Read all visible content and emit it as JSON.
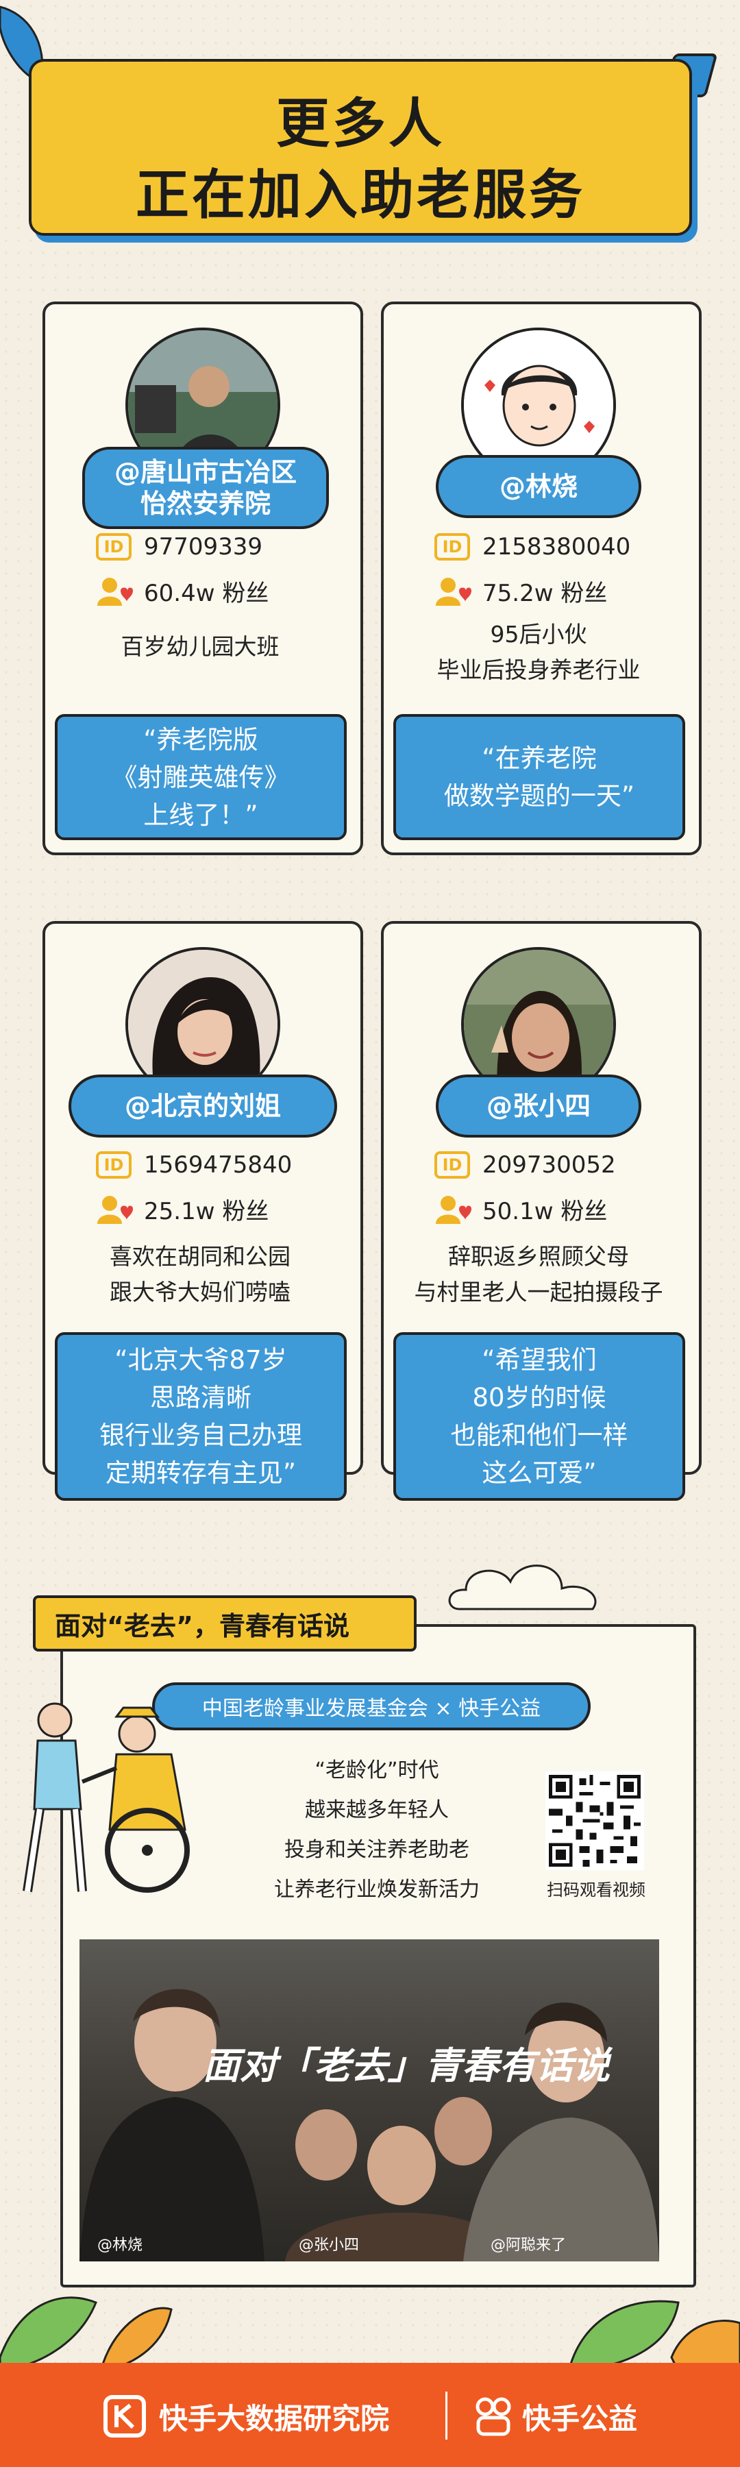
{
  "header": {
    "line1": "更多人",
    "line2": "正在加入助老服务"
  },
  "cards": [
    {
      "name": "@唐山市古冶区\n怡然安养院",
      "id": "97709339",
      "fans": "60.4w 粉丝",
      "desc": "百岁幼儿园大班",
      "quote": "“养老院版\n《射雕英雄传》\n上线了！”"
    },
    {
      "name": "@林烧",
      "id": "2158380040",
      "fans": "75.2w 粉丝",
      "desc": "95后小伙\n毕业后投身养老行业",
      "quote": "“在养老院\n做数学题的一天”"
    },
    {
      "name": "@北京的刘姐",
      "id": "1569475840",
      "fans": "25.1w 粉丝",
      "desc": "喜欢在胡同和公园\n跟大爷大妈们唠嗑",
      "quote": "“北京大爷87岁\n思路清晰\n银行业务自己办理\n定期转存有主见”"
    },
    {
      "name": "@张小四",
      "id": "209730052",
      "fans": "50.1w 粉丝",
      "desc": "辞职返乡照顾父母\n与村里老人一起拍摄段子",
      "quote": "“希望我们\n80岁的时候\n也能和他们一样\n这么可爱”"
    }
  ],
  "id_badge": "ID",
  "section": {
    "tag": "面对“老去”，青春有话说",
    "org": "中国老龄事业发展基金会 × 快手公益",
    "lines": [
      "“老龄化”时代",
      "越来越多年轻人",
      "投身和关注养老助老",
      "让养老行业焕发新活力"
    ],
    "qr_label": "扫码观看视频",
    "photo_title": "面对「老去」青春有话说",
    "photo_captions": [
      "@林烧",
      "@张小四",
      "@阿聪来了"
    ]
  },
  "footer": {
    "brand1": "快手大数据研究院",
    "brand2": "快手公益"
  },
  "colors": {
    "yellow": "#f5c531",
    "blue": "#3f9ad8",
    "orange": "#ef5a22",
    "bg": "#f4efe2"
  }
}
